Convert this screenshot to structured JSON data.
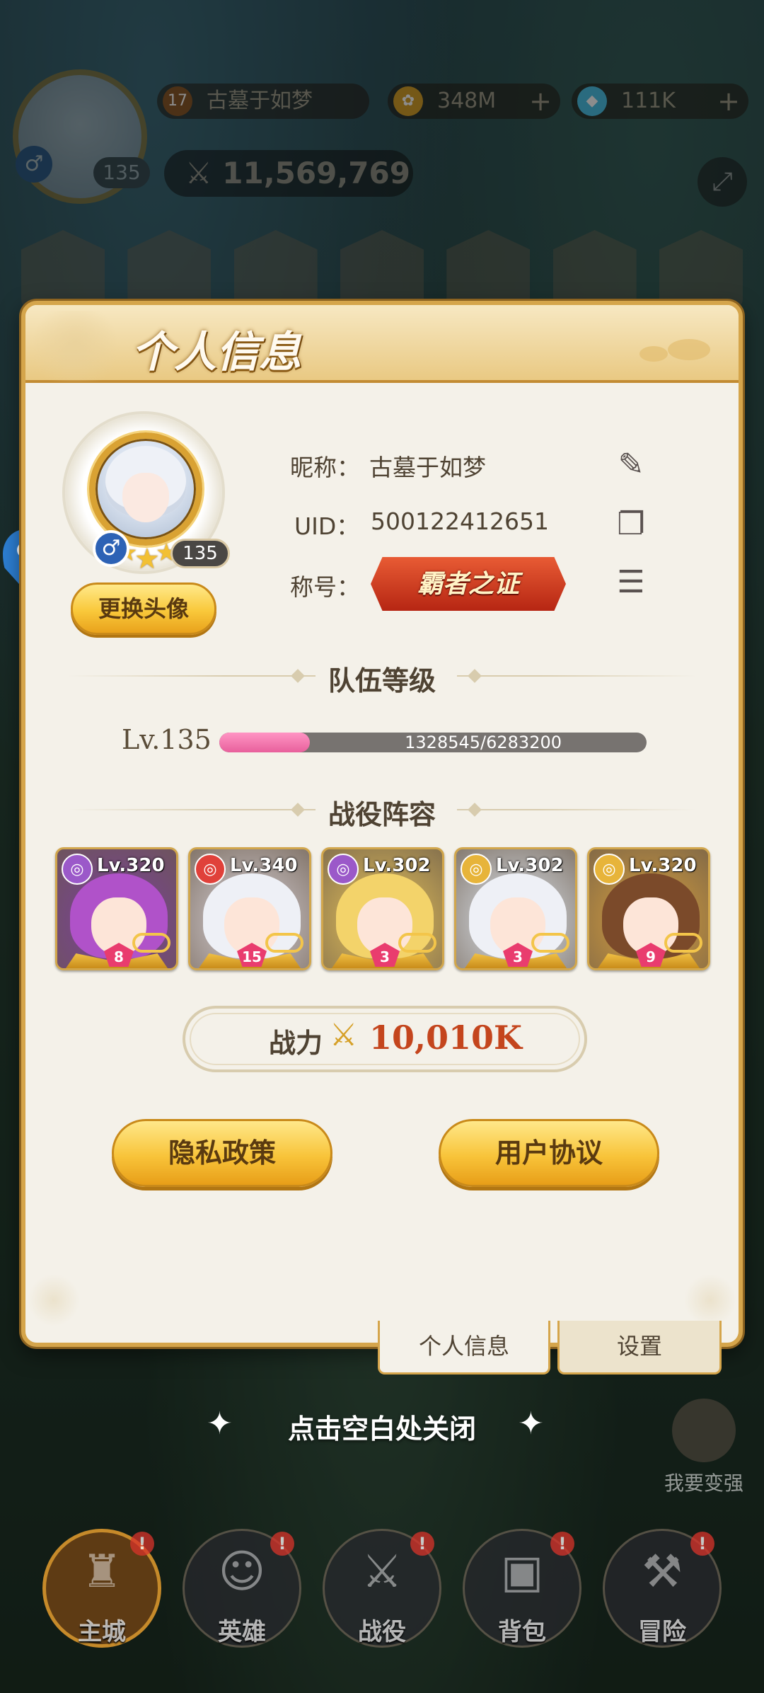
{
  "hud": {
    "player_name": "古墓于如梦",
    "vip_level": "17",
    "avatar_level": "135",
    "gender_symbol": "♂",
    "gold": "348M",
    "diamonds": "111K",
    "power": "11,569,769"
  },
  "panel": {
    "title": "个人信息",
    "change_avatar_label": "更换头像",
    "avatar_level": "135",
    "gender_symbol": "♂",
    "nickname_label": "昵称：",
    "nickname": "古墓于如梦",
    "uid_label": "UID：",
    "uid": "500122412651",
    "title_label": "称号：",
    "title_badge": "霸者之证",
    "team_level_section": "队伍等级",
    "team_level": "Lv.135",
    "exp_text": "1328545/6283200",
    "exp_progress": 0.2114,
    "lineup_section": "战役阵容",
    "heroes": [
      {
        "level": "Lv.320",
        "stars": "8",
        "class_color": "#9b59c9",
        "hair": "#b052c9"
      },
      {
        "level": "Lv.340",
        "stars": "15",
        "class_color": "#e0413a",
        "hair": "#eef0f6"
      },
      {
        "level": "Lv.302",
        "stars": "3",
        "class_color": "#9b59c9",
        "hair": "#f3d36a"
      },
      {
        "level": "Lv.302",
        "stars": "3",
        "class_color": "#e7b43a",
        "hair": "#eef0f6"
      },
      {
        "level": "Lv.320",
        "stars": "9",
        "class_color": "#e7b43a",
        "hair": "#7b4a2a"
      }
    ],
    "power_label": "战力",
    "power_value": "10,010K",
    "privacy_button": "隐私政策",
    "agreement_button": "用户协议"
  },
  "tabs": {
    "profile": "个人信息",
    "settings": "设置"
  },
  "close_hint": "点击空白处关闭",
  "side_button": "我要变强",
  "bottom_nav": [
    {
      "label": "主城",
      "glyph": "♜",
      "active": true
    },
    {
      "label": "英雄",
      "glyph": "☺",
      "active": false
    },
    {
      "label": "战役",
      "glyph": "⚔",
      "active": false
    },
    {
      "label": "背包",
      "glyph": "▣",
      "active": false
    },
    {
      "label": "冒险",
      "glyph": "⚒",
      "active": false
    }
  ],
  "icons": {
    "edit": "pencil-icon",
    "copy": "copy-icon",
    "list": "list-icon",
    "power": "crossed-swords-icon"
  }
}
